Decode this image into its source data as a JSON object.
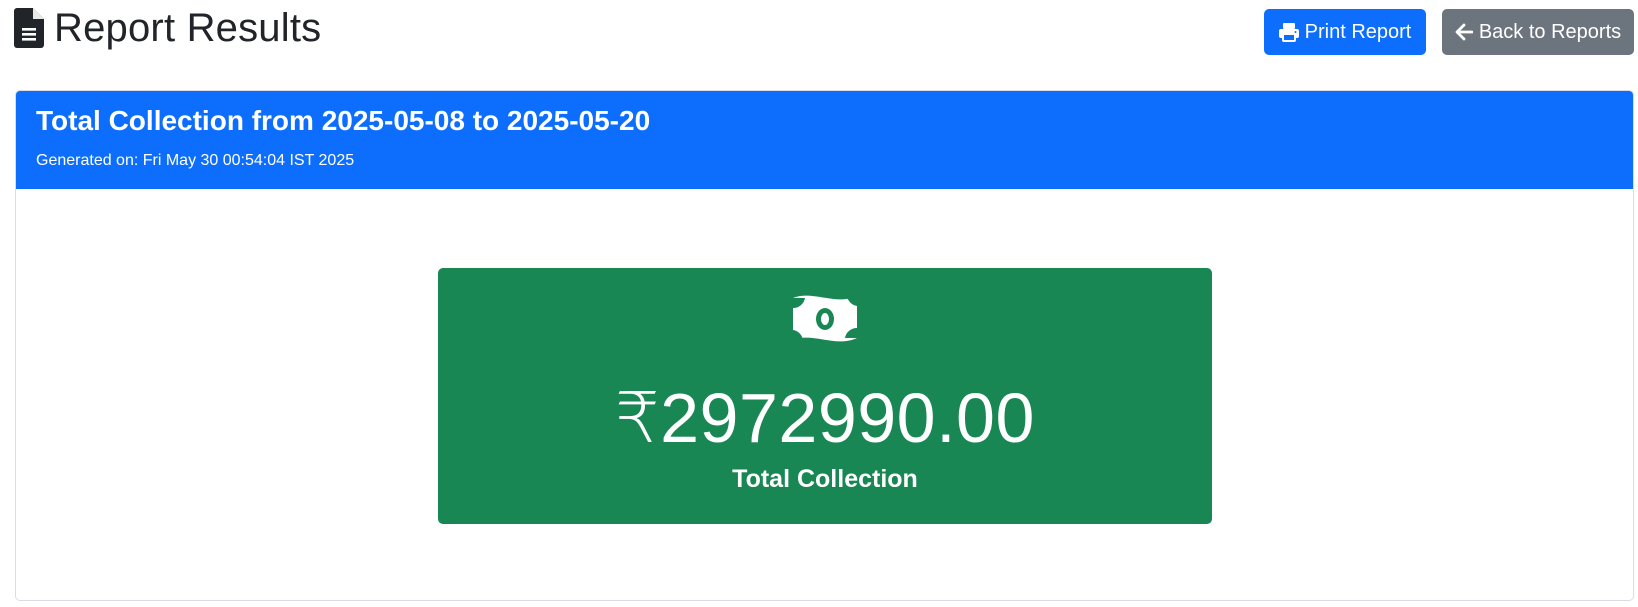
{
  "header": {
    "title": "Report Results",
    "icon": "file-text-icon"
  },
  "toolbar": {
    "print_label": "Print Report",
    "print_icon": "printer-icon",
    "back_label": "Back to Reports",
    "back_icon": "arrow-left-icon"
  },
  "report": {
    "title": "Total Collection from 2025-05-08 to 2025-05-20",
    "generated": "Generated on: Fri May 30 00:54:04 IST 2025"
  },
  "stat": {
    "icon": "money-bill-icon",
    "value": "₹2972990.00",
    "label": "Total Collection"
  },
  "colors": {
    "primary": "#0d6efd",
    "secondary": "#6c757d",
    "success": "#198754"
  }
}
